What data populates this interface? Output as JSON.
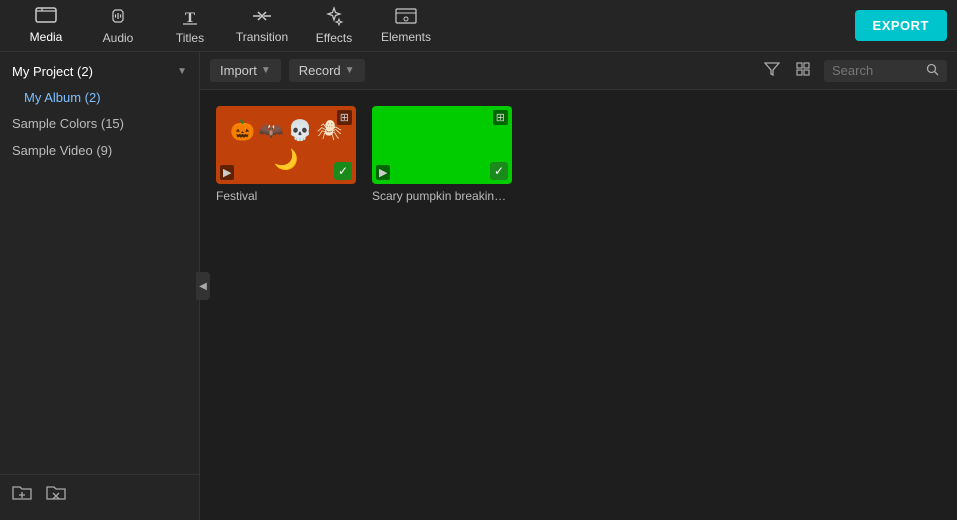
{
  "toolbar": {
    "items": [
      {
        "id": "media",
        "label": "Media",
        "icon": "🗂"
      },
      {
        "id": "audio",
        "label": "Audio",
        "icon": "♩"
      },
      {
        "id": "titles",
        "label": "Titles",
        "icon": "T"
      },
      {
        "id": "transition",
        "label": "Transition",
        "icon": "⇄"
      },
      {
        "id": "effects",
        "label": "Effects",
        "icon": "✦"
      },
      {
        "id": "elements",
        "label": "Elements",
        "icon": "🖼"
      }
    ],
    "export_label": "EXPORT"
  },
  "sidebar": {
    "project_label": "My Project (2)",
    "album_label": "My Album (2)",
    "sample_colors_label": "Sample Colors (15)",
    "sample_video_label": "Sample Video (9)"
  },
  "content": {
    "import_label": "Import",
    "record_label": "Record",
    "search_placeholder": "Search",
    "media_items": [
      {
        "id": "festival",
        "label": "Festival",
        "thumb_type": "festival"
      },
      {
        "id": "scary",
        "label": "Scary pumpkin breaking s...",
        "thumb_type": "green"
      }
    ]
  }
}
